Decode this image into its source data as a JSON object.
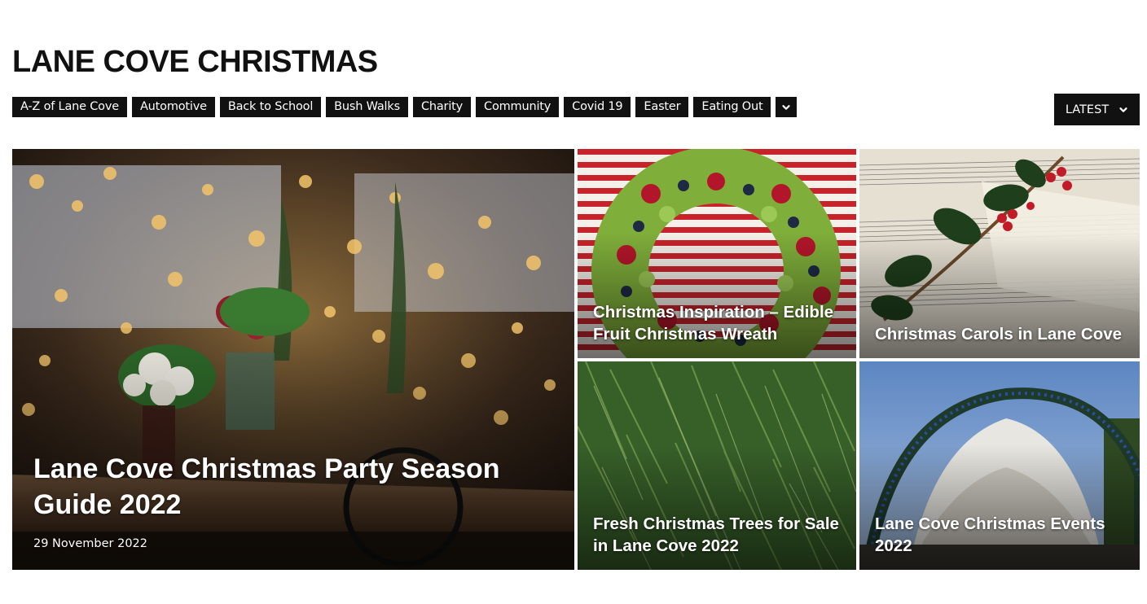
{
  "page": {
    "title": "LANE COVE CHRISTMAS"
  },
  "categories": [
    {
      "label": "A-Z of Lane Cove"
    },
    {
      "label": "Automotive"
    },
    {
      "label": "Back to School"
    },
    {
      "label": "Bush Walks"
    },
    {
      "label": "Charity"
    },
    {
      "label": "Community"
    },
    {
      "label": "Covid 19"
    },
    {
      "label": "Easter"
    },
    {
      "label": "Eating Out"
    }
  ],
  "category_more": {
    "icon": "chevron-down-icon"
  },
  "sort": {
    "label": "LATEST",
    "icon": "chevron-down-icon"
  },
  "featured": {
    "title": "Lane Cove Christmas Party Season Guide 2022",
    "date": "29 November 2022"
  },
  "tiles": [
    {
      "title": "Christmas Inspiration – Edible Fruit Christmas Wreath"
    },
    {
      "title": "Christmas Carols in Lane Cove"
    },
    {
      "title": "Fresh Christmas Trees for Sale in Lane Cove 2022"
    },
    {
      "title": "Lane Cove Christmas Events 2022"
    }
  ],
  "colors": {
    "tag_bg": "#111111",
    "tag_text": "#ffffff",
    "page_bg": "#ffffff"
  }
}
